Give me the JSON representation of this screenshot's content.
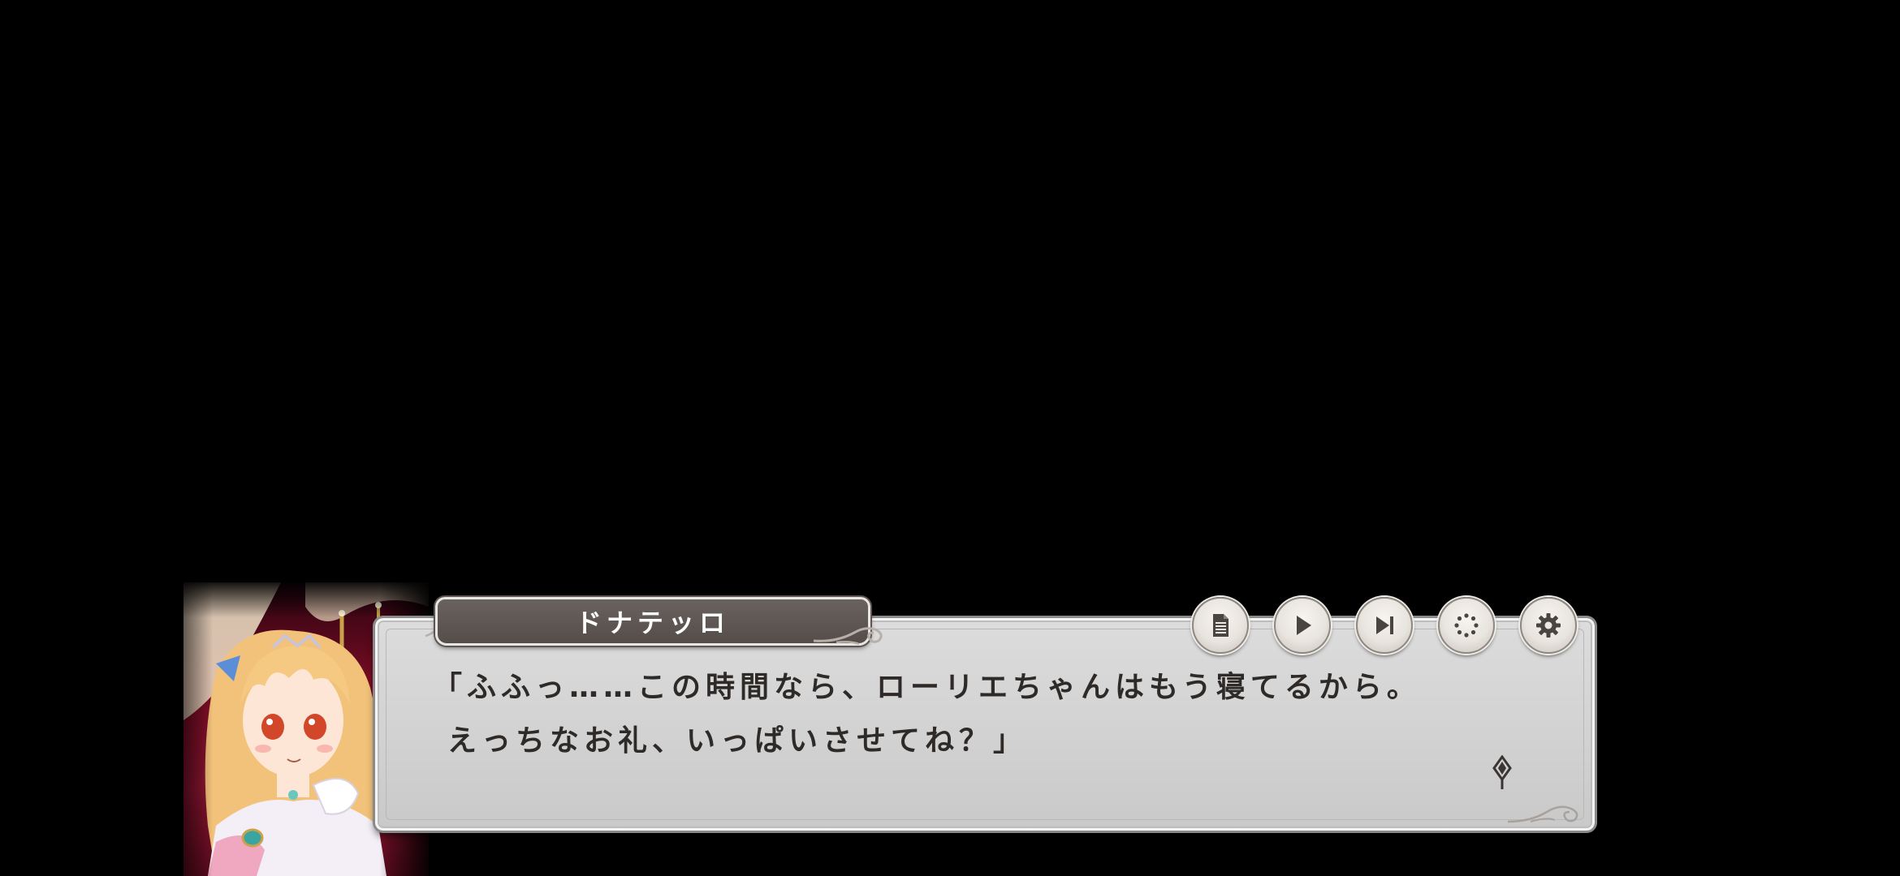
{
  "speaker": {
    "name": "ドナテッロ"
  },
  "dialogue": {
    "lines": [
      "「ふふっ……この時間なら、ローリエちゃんはもう寝てるから。",
      "えっちなお礼、いっぱいさせてね？」"
    ]
  },
  "toolbar": {
    "buttons": [
      {
        "id": "log",
        "icon": "document-icon"
      },
      {
        "id": "auto",
        "icon": "play-icon"
      },
      {
        "id": "skip",
        "icon": "skip-forward-icon"
      },
      {
        "id": "hide",
        "icon": "dotted-circle-icon"
      },
      {
        "id": "settings",
        "icon": "gear-icon"
      }
    ]
  },
  "colors": {
    "background": "#000000",
    "dialog_fill": "#d4d4d4",
    "dialog_text": "#2e2a28",
    "nameplate_fill": "#5c5551",
    "nameplate_text": "#ffffff",
    "button_fill": "#ece8e2",
    "icon_color": "#4a4541"
  }
}
